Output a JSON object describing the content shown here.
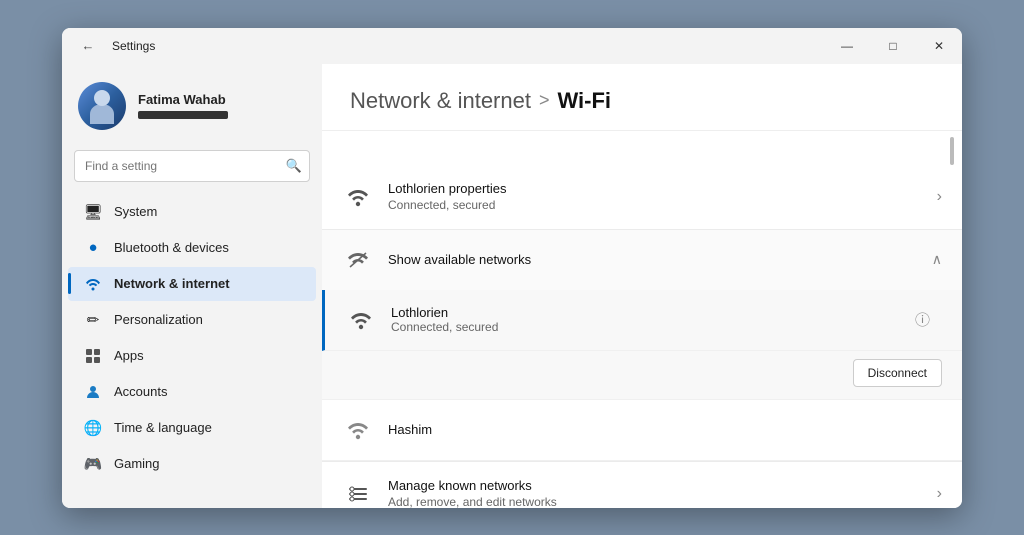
{
  "window": {
    "title": "Settings",
    "controls": {
      "minimize": "—",
      "maximize": "□",
      "close": "✕"
    }
  },
  "sidebar": {
    "user": {
      "name": "Fatima Wahab",
      "email_placeholder": "••••••••••••"
    },
    "search": {
      "placeholder": "Find a setting"
    },
    "nav": [
      {
        "id": "system",
        "label": "System",
        "icon": "🖥",
        "active": false
      },
      {
        "id": "bluetooth",
        "label": "Bluetooth & devices",
        "icon": "🔵",
        "active": false
      },
      {
        "id": "network",
        "label": "Network & internet",
        "icon": "◆",
        "active": true
      },
      {
        "id": "personalization",
        "label": "Personalization",
        "icon": "✏",
        "active": false
      },
      {
        "id": "apps",
        "label": "Apps",
        "icon": "📦",
        "active": false
      },
      {
        "id": "accounts",
        "label": "Accounts",
        "icon": "👤",
        "active": false
      },
      {
        "id": "time",
        "label": "Time & language",
        "icon": "🌐",
        "active": false
      },
      {
        "id": "gaming",
        "label": "Gaming",
        "icon": "🎮",
        "active": false
      }
    ]
  },
  "header": {
    "parent": "Network & internet",
    "separator": ">",
    "current": "Wi-Fi"
  },
  "content": {
    "lothlorien_properties": {
      "title": "Lothlorien properties",
      "subtitle": "Connected, secured"
    },
    "show_networks": {
      "label": "Show available networks"
    },
    "connected_network": {
      "name": "Lothlorien",
      "status": "Connected, secured",
      "info_icon": "ⓘ",
      "disconnect_label": "Disconnect"
    },
    "hashim": {
      "name": "Hashim"
    },
    "manage_known": {
      "title": "Manage known networks",
      "subtitle": "Add, remove, and edit networks"
    }
  }
}
